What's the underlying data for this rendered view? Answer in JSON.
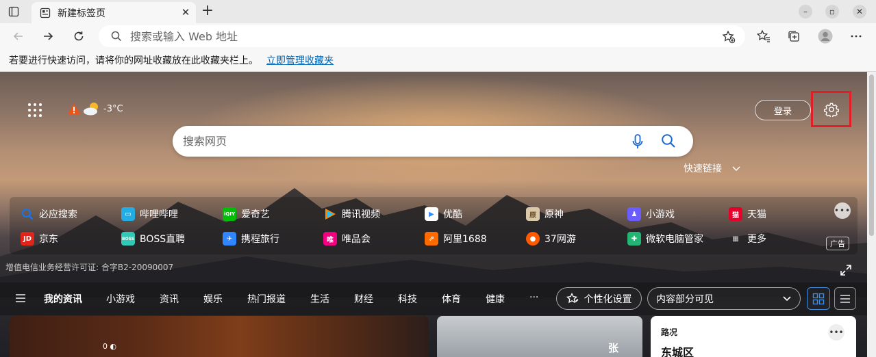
{
  "browser": {
    "tab": {
      "title": "新建标签页"
    },
    "omnibox": {
      "placeholder": "搜索或输入 Web 地址"
    },
    "favbar": {
      "text": "若要进行快速访问，请将你的网址收藏放在此收藏夹栏上。",
      "link": "立即管理收藏夹"
    }
  },
  "ntp": {
    "weather": {
      "temp": "-3°C"
    },
    "login_label": "登录",
    "search_placeholder": "搜索网页",
    "quicklinks_label": "快速链接",
    "quicklinks": [
      {
        "label": "必应搜索",
        "icon": "bing-search-icon",
        "color": "#1a73e8"
      },
      {
        "label": "哔哩哔哩",
        "icon": "bilibili-icon",
        "color": "#23ade5"
      },
      {
        "label": "爱奇艺",
        "icon": "iqiyi-icon",
        "color": "#00be06"
      },
      {
        "label": "腾讯视频",
        "icon": "tencent-video-icon",
        "color": "#ff8a00"
      },
      {
        "label": "优酷",
        "icon": "youku-icon",
        "color": "#2b8cff"
      },
      {
        "label": "原神",
        "icon": "genshin-icon",
        "color": "#d9c9a8"
      },
      {
        "label": "小游戏",
        "icon": "mini-games-icon",
        "color": "#6a5cff"
      },
      {
        "label": "天猫",
        "icon": "tmall-icon",
        "color": "#e4002b"
      },
      {
        "label": "京东",
        "icon": "jd-icon",
        "color": "#e1251b"
      },
      {
        "label": "BOSS直聘",
        "icon": "boss-zhipin-icon",
        "color": "#2fc9b6"
      },
      {
        "label": "携程旅行",
        "icon": "ctrip-icon",
        "color": "#2f86ff"
      },
      {
        "label": "唯品会",
        "icon": "vipshop-icon",
        "color": "#f10180"
      },
      {
        "label": "阿里1688",
        "icon": "alibaba-1688-icon",
        "color": "#ff6a00"
      },
      {
        "label": "37网游",
        "icon": "37-games-icon",
        "color": "#ff5a00"
      },
      {
        "label": "微软电脑管家",
        "icon": "pc-manager-icon",
        "color": "#22b573"
      },
      {
        "label": "更多",
        "icon": "more-apps-icon",
        "color": "#9a9a9a"
      }
    ],
    "ad_label": "广告",
    "license": "增值电信业务经营许可证: 合字B2-20090007"
  },
  "feed": {
    "tabs": [
      "我的资讯",
      "小游戏",
      "资讯",
      "娱乐",
      "热门报道",
      "生活",
      "财经",
      "科技",
      "体育",
      "健康",
      "···"
    ],
    "personalize_label": "个性化设置",
    "content_select_value": "内容部分可见",
    "cards": {
      "card1_badge": "0 ◐",
      "card2_title": "张",
      "card3_label": "路况",
      "card3_district": "东城区"
    }
  },
  "colors": {
    "accent": "#0066b4",
    "highlight_border": "#e41e26"
  }
}
